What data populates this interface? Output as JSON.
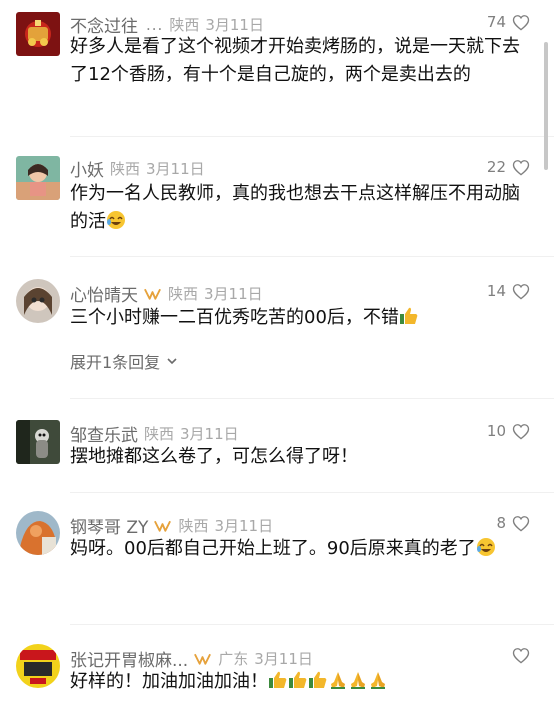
{
  "comments": [
    {
      "username": "不念过往",
      "ellipsis": "...",
      "region": "陕西",
      "date": "3月11日",
      "likes": "74",
      "text": "好多人是看了这个视频才开始卖烤肠的，说是一天就下去了12个香肠，有十个是自己旋的，两个是卖出去的"
    },
    {
      "username": "小妖",
      "region": "陕西",
      "date": "3月11日",
      "likes": "22",
      "text": "作为一名人民教师，真的我也想去干点这样解压不用动脑的活"
    },
    {
      "username": "心怡晴天",
      "region": "陕西",
      "date": "3月11日",
      "likes": "14",
      "text": "三个小时赚一二百优秀吃苦的00后，不错",
      "expand_label": "展开1条回复"
    },
    {
      "username": "邹查乐武",
      "region": "陕西",
      "date": "3月11日",
      "likes": "10",
      "text": "摆地摊都这么卷了，可怎么得了呀！"
    },
    {
      "username": "钢琴哥 ZY",
      "region": "陕西",
      "date": "3月11日",
      "likes": "8",
      "text": "妈呀。00后都自己开始上班了。90后原来真的老了"
    },
    {
      "username": "张记开胃椒麻...",
      "region": "广东",
      "date": "3月11日",
      "likes": "",
      "text": "好样的！加油加油加油！"
    }
  ],
  "colors": {
    "username": "#6b6b6b",
    "meta": "#a8a8a8",
    "text": "#111111",
    "badge": "#e6a23c"
  },
  "icons": [
    "heart-outline-icon",
    "chevron-down-icon",
    "verified-badge-icon",
    "laugh-cry-emoji",
    "thumbs-up-emoji",
    "praying-hands-emoji"
  ]
}
